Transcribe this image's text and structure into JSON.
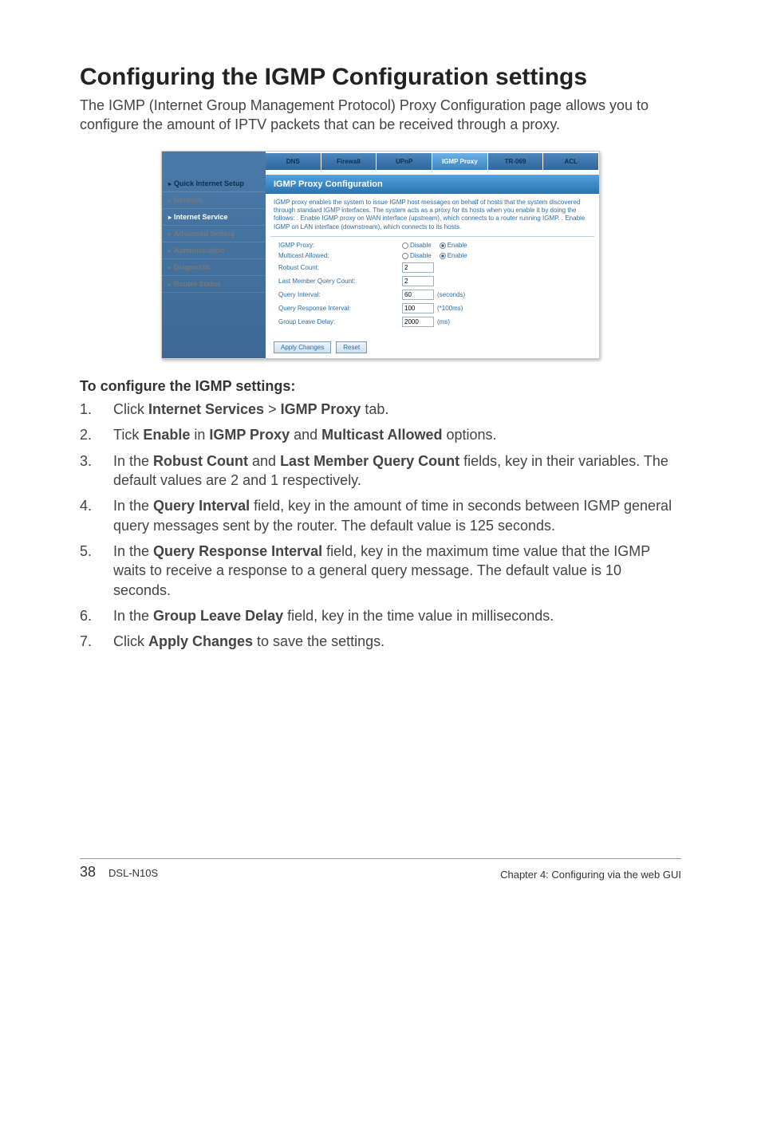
{
  "heading": "Configuring the IGMP Configuration settings",
  "intro": "The IGMP (Internet Group Management Protocol) Proxy Configuration page allows you to configure the amount of IPTV packets that can be received through a proxy.",
  "screenshot": {
    "nav": [
      {
        "label": "Quick Internet Setup",
        "state": "default"
      },
      {
        "label": "Network",
        "state": "inactive"
      },
      {
        "label": "Internet Service",
        "state": "active"
      },
      {
        "label": "Advanced Setting",
        "state": "inactive"
      },
      {
        "label": "Administration",
        "state": "inactive"
      },
      {
        "label": "Diagnostic",
        "state": "inactive"
      },
      {
        "label": "Router Status",
        "state": "inactive"
      }
    ],
    "tabs": [
      {
        "label": "DNS"
      },
      {
        "label": "Firewall"
      },
      {
        "label": "UPnP"
      },
      {
        "label": "IGMP Proxy",
        "active": true
      },
      {
        "label": "TR-069"
      },
      {
        "label": "ACL"
      }
    ],
    "panel_title": "IGMP Proxy Configuration",
    "desc": "IGMP proxy enables the system to issue IGMP host messages on behalf of hosts that the system discovered through standard IGMP interfaces. The system acts as a proxy for its hosts when you enable it by doing the follows:\n. Enable IGMP proxy on WAN interface (upstream), which connects to a router running IGMP.\n. Enable IGMP on LAN interface (downstream), which connects to its hosts.",
    "rows": {
      "igmp_proxy": {
        "label": "IGMP Proxy:",
        "disable": "Disable",
        "enable": "Enable",
        "selected": "enable"
      },
      "multicast": {
        "label": "Multicast Allowed:",
        "disable": "Disable",
        "enable": "Enable",
        "selected": "enable"
      },
      "robust_count": {
        "label": "Robust Count:",
        "value": "2"
      },
      "last_member": {
        "label": "Last Member Query Count:",
        "value": "2"
      },
      "query_interval": {
        "label": "Query Interval:",
        "value": "60",
        "unit": "(seconds)"
      },
      "query_response": {
        "label": "Query Response Interval:",
        "value": "100",
        "unit": "(*100ms)"
      },
      "group_leave": {
        "label": "Group Leave Delay:",
        "value": "2000",
        "unit": "(ms)"
      }
    },
    "buttons": {
      "apply": "Apply Changes",
      "reset": "Reset"
    }
  },
  "subhead": "To configure the IGMP settings:",
  "steps": {
    "s1": {
      "a": "Click ",
      "b": "Internet Services",
      "c": " > ",
      "d": "IGMP Proxy",
      "e": " tab."
    },
    "s2": {
      "a": "Tick ",
      "b": "Enable",
      "c": " in ",
      "d": "IGMP Proxy",
      "e": " and ",
      "f": "Multicast Allowed",
      "g": " options."
    },
    "s3": {
      "a": "In the ",
      "b": "Robust Count",
      "c": " and ",
      "d": "Last Member Query Count",
      "e": " fields, key in their variables. The default values are 2 and 1 respectively."
    },
    "s4": {
      "a": "In the ",
      "b": "Query Interval",
      "c": " field, key in the amount of time in seconds between IGMP general query messages sent by the router. The default value is 125 seconds."
    },
    "s5": {
      "a": "In the ",
      "b": "Query Response Interval",
      "c": " field, key in the maximum time value that the IGMP waits to receive a response to a general query message. The default value is 10 seconds."
    },
    "s6": {
      "a": "In the ",
      "b": "Group Leave Delay",
      "c": " field, key in the time value in milliseconds."
    },
    "s7": {
      "a": "Click ",
      "b": "Apply Changes",
      "c": " to save the settings."
    }
  },
  "footer": {
    "page": "38",
    "model": "DSL-N10S",
    "chapter": "Chapter 4: Configuring via the web GUI"
  }
}
